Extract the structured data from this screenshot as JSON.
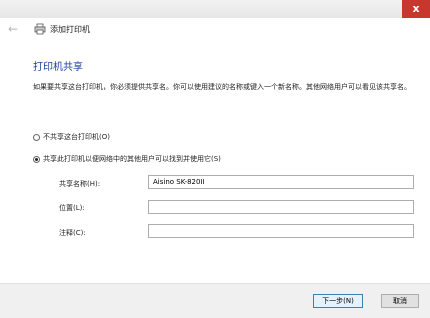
{
  "window": {
    "close_glyph": "x"
  },
  "nav": {
    "wizard_title": "添加打印机",
    "back_icon": "back-arrow-icon",
    "printer_icon": "printer-icon"
  },
  "page": {
    "heading": "打印机共享",
    "description": "如果要共享这台打印机，你必须提供共享名。你可以使用建议的名称或键入一个新名称。其他网络用户可以看见该共享名。"
  },
  "options": [
    {
      "label": "不共享这台打印机(O)",
      "selected": false
    },
    {
      "label": "共享此打印机以便网络中的其他用户可以找到并使用它(S)",
      "selected": true
    }
  ],
  "fields": {
    "share_name": {
      "label": "共享名称(H):",
      "value": "Aisino SK-820II"
    },
    "location": {
      "label": "位置(L):",
      "value": ""
    },
    "comment": {
      "label": "注释(C):",
      "value": ""
    }
  },
  "buttons": {
    "next": "下一步(N)",
    "cancel": "取消"
  },
  "colors": {
    "heading": "#1e3f99",
    "close_button": "#c7372d",
    "primary_button_border": "#3c7fb1"
  }
}
